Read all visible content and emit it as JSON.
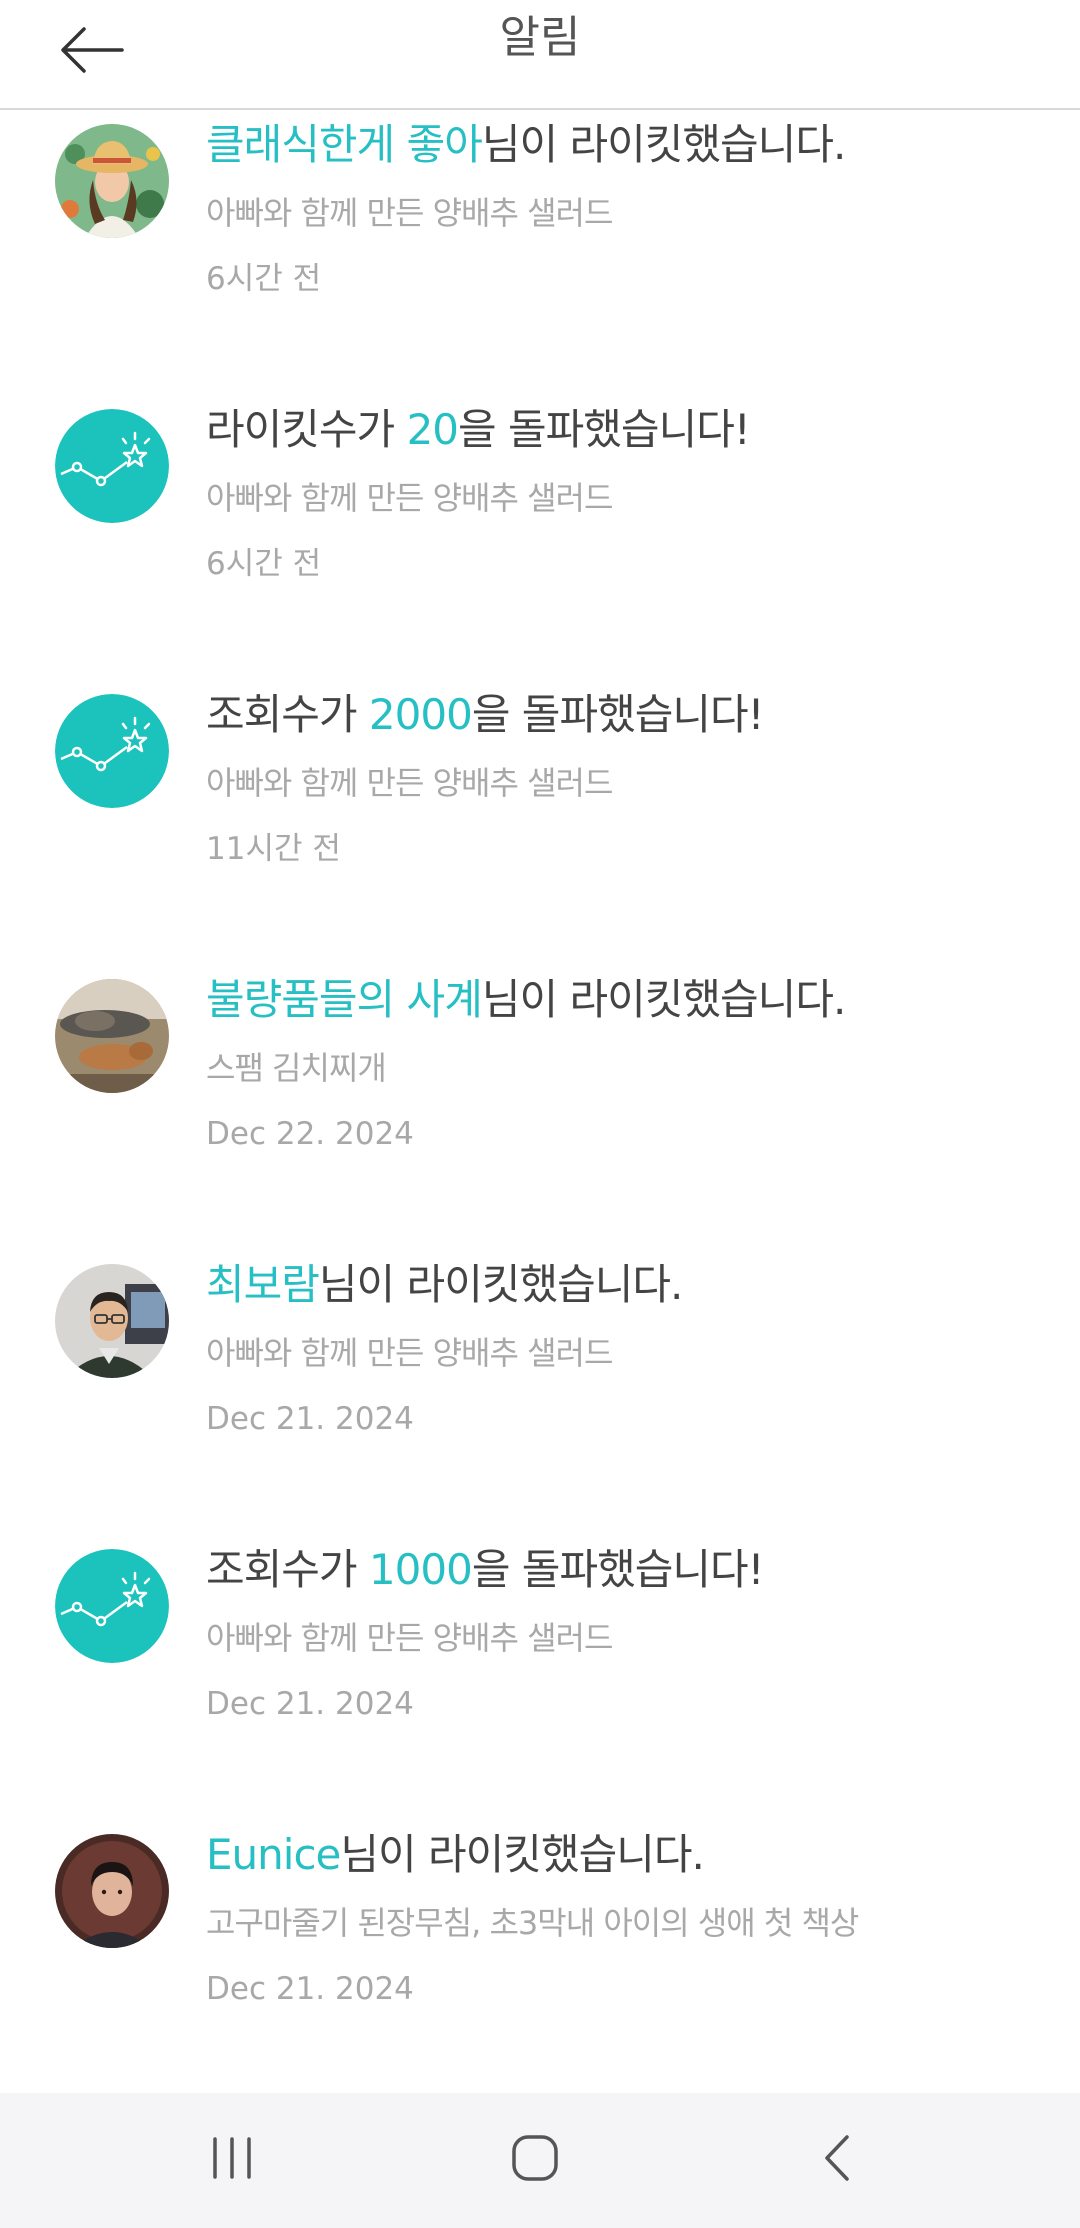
{
  "header": {
    "title": "알림"
  },
  "colors": {
    "accent": "#26bfc4",
    "text": "#444444",
    "muted": "#a8a8a8",
    "navbar": "#f5f5f7"
  },
  "notifications": [
    {
      "icon": "user-avatar-girl-hat",
      "pre": "",
      "hl": "클래식한게 좋아",
      "post": "님이 라이킷했습니다.",
      "sub": "아빠와 함께 만든 양배추 샐러드",
      "time": "6시간 전"
    },
    {
      "icon": "milestone-star-icon",
      "pre": "라이킷수가 ",
      "hl": "20",
      "post": "을 돌파했습니다!",
      "sub": "아빠와 함께 만든 양배추 샐러드",
      "time": "6시간 전"
    },
    {
      "icon": "milestone-star-icon",
      "pre": "조회수가 ",
      "hl": "2000",
      "post": "을 돌파했습니다!",
      "sub": "아빠와 함께 만든 양배추 샐러드",
      "time": "11시간 전"
    },
    {
      "icon": "user-avatar-dog-photo",
      "pre": "",
      "hl": "불량품들의 사계",
      "post": "님이 라이킷했습니다.",
      "sub": "스팸 김치찌개",
      "time": "Dec 22. 2024"
    },
    {
      "icon": "user-avatar-man-glasses",
      "pre": "",
      "hl": "최보람",
      "post": "님이 라이킷했습니다.",
      "sub": "아빠와 함께 만든 양배추 샐러드",
      "time": "Dec 21. 2024"
    },
    {
      "icon": "milestone-star-icon",
      "pre": "조회수가 ",
      "hl": "1000",
      "post": "을 돌파했습니다!",
      "sub": "아빠와 함께 만든 양배추 샐러드",
      "time": "Dec 21. 2024"
    },
    {
      "icon": "user-avatar-child-photo",
      "pre": "",
      "hl": "Eunice",
      "post": "님이 라이킷했습니다.",
      "sub": "고구마줄기 된장무침, 초3막내 아이의 생애 첫 책상",
      "time": "Dec 21. 2024"
    }
  ],
  "navbar": {
    "recents_icon": "recent-apps-icon",
    "home_icon": "home-icon",
    "back_icon": "back-icon"
  }
}
